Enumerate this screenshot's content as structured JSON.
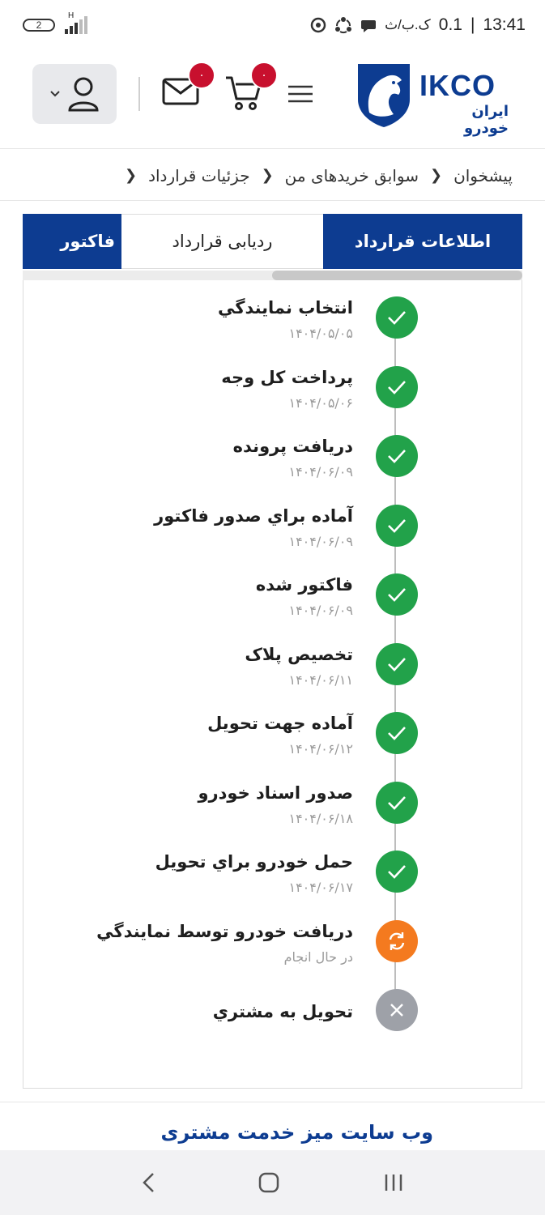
{
  "status_bar": {
    "time": "13:41",
    "network_speed": "0.1",
    "speed_unit": "ک.ب/ث",
    "separator": "|",
    "sim_label": "2",
    "network_type": "H"
  },
  "header": {
    "cart_count": "۰",
    "mail_count": "۰",
    "logo_text": "IKCO",
    "logo_subtext": "ایران خودرو"
  },
  "breadcrumb": {
    "items": [
      "پیشخوان",
      "سوابق خریدهای من",
      "جزئیات قرارداد"
    ]
  },
  "tabs": [
    {
      "label": "اطلاعات قرارداد",
      "active": true
    },
    {
      "label": "ردیابی قرارداد",
      "active": false
    },
    {
      "label": "فاکتور",
      "active": true
    }
  ],
  "timeline": [
    {
      "title": "انتخاب نمايندگي",
      "date": "۱۴۰۴/۰۵/۰۵",
      "status": "done"
    },
    {
      "title": "پرداخت کل وجه",
      "date": "۱۴۰۴/۰۵/۰۶",
      "status": "done"
    },
    {
      "title": "دريافت پرونده",
      "date": "۱۴۰۴/۰۶/۰۹",
      "status": "done"
    },
    {
      "title": "آماده براي صدور فاکتور",
      "date": "۱۴۰۴/۰۶/۰۹",
      "status": "done"
    },
    {
      "title": "فاکتور شده",
      "date": "۱۴۰۴/۰۶/۰۹",
      "status": "done"
    },
    {
      "title": "تخصيص پلاک",
      "date": "۱۴۰۴/۰۶/۱۱",
      "status": "done"
    },
    {
      "title": "آماده جهت تحويل",
      "date": "۱۴۰۴/۰۶/۱۲",
      "status": "done"
    },
    {
      "title": "صدور اسناد خودرو",
      "date": "۱۴۰۴/۰۶/۱۸",
      "status": "done"
    },
    {
      "title": "حمل خودرو براي تحويل",
      "date": "۱۴۰۴/۰۶/۱۷",
      "status": "done"
    },
    {
      "title": "دريافت خودرو توسط نمايندگي",
      "date": "در حال انجام",
      "status": "progress"
    },
    {
      "title": "تحويل به مشتري",
      "date": "",
      "status": "pending"
    }
  ],
  "footer": {
    "title": "وب سایت میز خدمت مشتری"
  },
  "colors": {
    "brand_blue": "#0d3c91",
    "done_green": "#22a24a",
    "progress_orange": "#f47a1f",
    "pending_gray": "#9ea1a8",
    "badge_red": "#c8102e"
  }
}
